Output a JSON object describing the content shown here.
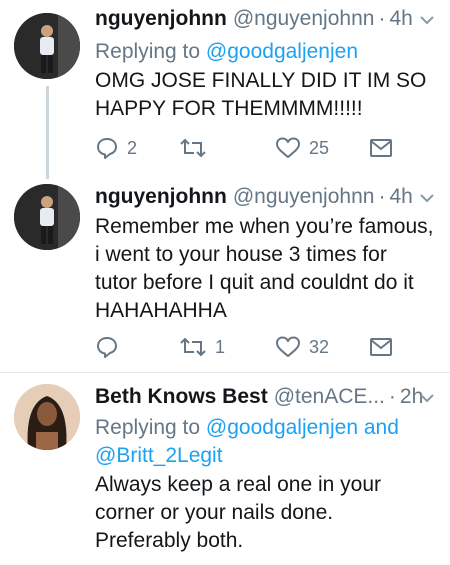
{
  "tweets": [
    {
      "name": "nguyenjohnn",
      "handle": "@nguyenjohnn",
      "sep": "·",
      "time": "4h",
      "replying_prefix": "Replying to",
      "replying_to": "@goodgaljenjen",
      "lines": [
        "OMG JOSE FINALLY DID IT IM SO",
        "HAPPY FOR THEMMMM!!!!!"
      ],
      "replies": "2",
      "retweets": "",
      "likes": "25"
    },
    {
      "name": "nguyenjohnn",
      "handle": "@nguyenjohnn",
      "sep": "·",
      "time": "4h",
      "lines": [
        "Remember me when you’re famous,",
        "i went to your house 3 times for",
        "tutor before I quit and couldnt do it",
        "HAHAHAHHA"
      ],
      "replies": "",
      "retweets": "1",
      "likes": "32"
    },
    {
      "name": "Beth Knows Best",
      "handle": "@tenACE...",
      "sep": "·",
      "time": "2h",
      "replying_prefix": "Replying to",
      "replying_to": "@goodgaljenjen and",
      "replying_to_2": "@Britt_2Legit",
      "lines": [
        "Always keep a real one in your",
        "corner or your nails done.",
        "Preferably both."
      ]
    }
  ],
  "colors": {
    "accent": "#1da1f2",
    "muted": "#657786",
    "text": "#14171a",
    "divider": "#e1e8ed"
  }
}
